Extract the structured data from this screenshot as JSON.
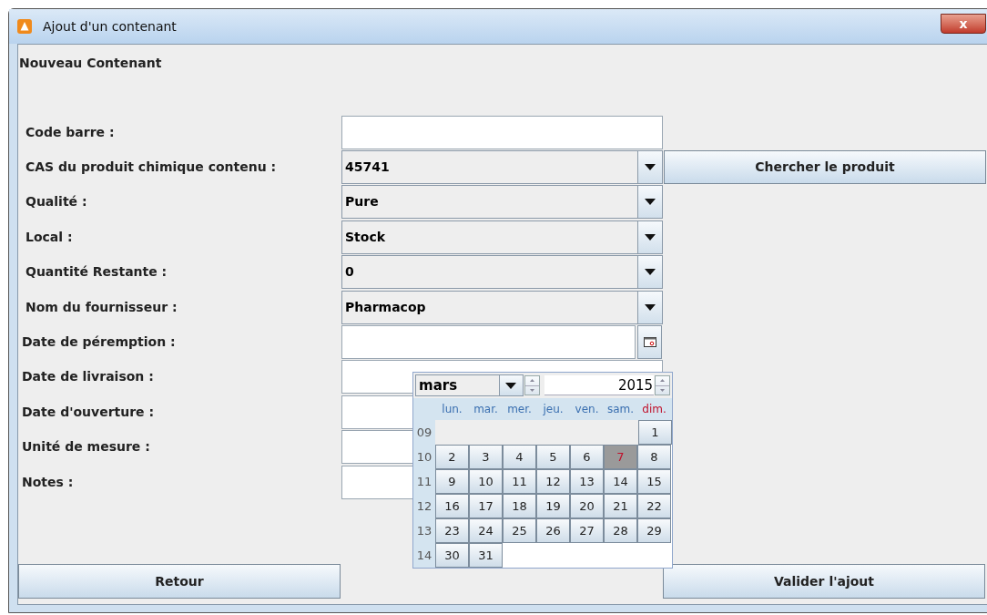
{
  "window": {
    "title": "Ajout d'un contenant",
    "close": "x"
  },
  "heading": "Nouveau Contenant",
  "fields": [
    {
      "kind": "text",
      "label": "Code barre :"
    },
    {
      "kind": "combo",
      "label": "CAS du produit chimique contenu :",
      "value": "45741",
      "button": "Chercher le produit"
    },
    {
      "kind": "combo",
      "label": "Qualité :",
      "value": "Pure"
    },
    {
      "kind": "combo",
      "label": "Local :",
      "value": "Stock"
    },
    {
      "kind": "combo",
      "label": "Quantité Restante :",
      "value": "0"
    },
    {
      "kind": "combo",
      "label": "Nom du fournisseur :",
      "value": "Pharmacop"
    },
    {
      "kind": "date",
      "label": "Date de péremption :"
    },
    {
      "kind": "text",
      "label": "Date de livraison :"
    },
    {
      "kind": "text",
      "label": "Date d'ouverture :"
    },
    {
      "kind": "text",
      "label": "Unité de mesure :"
    },
    {
      "kind": "text",
      "label": "Notes :"
    }
  ],
  "calendar": {
    "month": "mars",
    "year": "2015",
    "weekdays": [
      {
        "label": "lun.",
        "color": "#3a6fb0"
      },
      {
        "label": "mar.",
        "color": "#3a6fb0"
      },
      {
        "label": "mer.",
        "color": "#3a6fb0"
      },
      {
        "label": "jeu.",
        "color": "#3a6fb0"
      },
      {
        "label": "ven.",
        "color": "#3a6fb0"
      },
      {
        "label": "sam.",
        "color": "#3a6fb0"
      },
      {
        "label": "dim.",
        "color": "#c0102a"
      }
    ],
    "weeks": [
      {
        "number": "09",
        "kind": "first",
        "days": [
          {
            "label": "1",
            "selected": false
          }
        ]
      },
      {
        "number": "10",
        "kind": "regular",
        "days": [
          {
            "label": "2",
            "selected": false
          },
          {
            "label": "3",
            "selected": false
          },
          {
            "label": "4",
            "selected": false
          },
          {
            "label": "5",
            "selected": false
          },
          {
            "label": "6",
            "selected": false
          },
          {
            "label": "7",
            "selected": true
          },
          {
            "label": "8",
            "selected": false
          }
        ]
      },
      {
        "number": "11",
        "kind": "regular",
        "days": [
          {
            "label": "9",
            "selected": false
          },
          {
            "label": "10",
            "selected": false
          },
          {
            "label": "11",
            "selected": false
          },
          {
            "label": "12",
            "selected": false
          },
          {
            "label": "13",
            "selected": false
          },
          {
            "label": "14",
            "selected": false
          },
          {
            "label": "15",
            "selected": false
          }
        ]
      },
      {
        "number": "12",
        "kind": "regular",
        "days": [
          {
            "label": "16",
            "selected": false
          },
          {
            "label": "17",
            "selected": false
          },
          {
            "label": "18",
            "selected": false
          },
          {
            "label": "19",
            "selected": false
          },
          {
            "label": "20",
            "selected": false
          },
          {
            "label": "21",
            "selected": false
          },
          {
            "label": "22",
            "selected": false
          }
        ]
      },
      {
        "number": "13",
        "kind": "regular",
        "days": [
          {
            "label": "23",
            "selected": false
          },
          {
            "label": "24",
            "selected": false
          },
          {
            "label": "25",
            "selected": false
          },
          {
            "label": "26",
            "selected": false
          },
          {
            "label": "27",
            "selected": false
          },
          {
            "label": "28",
            "selected": false
          },
          {
            "label": "29",
            "selected": false
          }
        ]
      },
      {
        "number": "14",
        "kind": "regular",
        "days": [
          {
            "label": "30",
            "selected": false
          },
          {
            "label": "31",
            "selected": false
          }
        ]
      }
    ]
  },
  "buttons": {
    "back": "Retour",
    "submit": "Valider l'ajout"
  }
}
